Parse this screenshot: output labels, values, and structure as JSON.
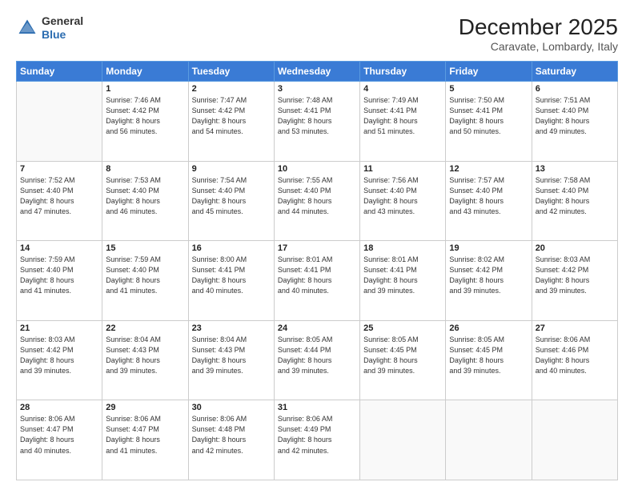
{
  "header": {
    "logo_general": "General",
    "logo_blue": "Blue",
    "month": "December 2025",
    "location": "Caravate, Lombardy, Italy"
  },
  "days_of_week": [
    "Sunday",
    "Monday",
    "Tuesday",
    "Wednesday",
    "Thursday",
    "Friday",
    "Saturday"
  ],
  "weeks": [
    [
      {
        "day": "",
        "info": ""
      },
      {
        "day": "1",
        "info": "Sunrise: 7:46 AM\nSunset: 4:42 PM\nDaylight: 8 hours\nand 56 minutes."
      },
      {
        "day": "2",
        "info": "Sunrise: 7:47 AM\nSunset: 4:42 PM\nDaylight: 8 hours\nand 54 minutes."
      },
      {
        "day": "3",
        "info": "Sunrise: 7:48 AM\nSunset: 4:41 PM\nDaylight: 8 hours\nand 53 minutes."
      },
      {
        "day": "4",
        "info": "Sunrise: 7:49 AM\nSunset: 4:41 PM\nDaylight: 8 hours\nand 51 minutes."
      },
      {
        "day": "5",
        "info": "Sunrise: 7:50 AM\nSunset: 4:41 PM\nDaylight: 8 hours\nand 50 minutes."
      },
      {
        "day": "6",
        "info": "Sunrise: 7:51 AM\nSunset: 4:40 PM\nDaylight: 8 hours\nand 49 minutes."
      }
    ],
    [
      {
        "day": "7",
        "info": "Sunrise: 7:52 AM\nSunset: 4:40 PM\nDaylight: 8 hours\nand 47 minutes."
      },
      {
        "day": "8",
        "info": "Sunrise: 7:53 AM\nSunset: 4:40 PM\nDaylight: 8 hours\nand 46 minutes."
      },
      {
        "day": "9",
        "info": "Sunrise: 7:54 AM\nSunset: 4:40 PM\nDaylight: 8 hours\nand 45 minutes."
      },
      {
        "day": "10",
        "info": "Sunrise: 7:55 AM\nSunset: 4:40 PM\nDaylight: 8 hours\nand 44 minutes."
      },
      {
        "day": "11",
        "info": "Sunrise: 7:56 AM\nSunset: 4:40 PM\nDaylight: 8 hours\nand 43 minutes."
      },
      {
        "day": "12",
        "info": "Sunrise: 7:57 AM\nSunset: 4:40 PM\nDaylight: 8 hours\nand 43 minutes."
      },
      {
        "day": "13",
        "info": "Sunrise: 7:58 AM\nSunset: 4:40 PM\nDaylight: 8 hours\nand 42 minutes."
      }
    ],
    [
      {
        "day": "14",
        "info": "Sunrise: 7:59 AM\nSunset: 4:40 PM\nDaylight: 8 hours\nand 41 minutes."
      },
      {
        "day": "15",
        "info": "Sunrise: 7:59 AM\nSunset: 4:40 PM\nDaylight: 8 hours\nand 41 minutes."
      },
      {
        "day": "16",
        "info": "Sunrise: 8:00 AM\nSunset: 4:41 PM\nDaylight: 8 hours\nand 40 minutes."
      },
      {
        "day": "17",
        "info": "Sunrise: 8:01 AM\nSunset: 4:41 PM\nDaylight: 8 hours\nand 40 minutes."
      },
      {
        "day": "18",
        "info": "Sunrise: 8:01 AM\nSunset: 4:41 PM\nDaylight: 8 hours\nand 39 minutes."
      },
      {
        "day": "19",
        "info": "Sunrise: 8:02 AM\nSunset: 4:42 PM\nDaylight: 8 hours\nand 39 minutes."
      },
      {
        "day": "20",
        "info": "Sunrise: 8:03 AM\nSunset: 4:42 PM\nDaylight: 8 hours\nand 39 minutes."
      }
    ],
    [
      {
        "day": "21",
        "info": "Sunrise: 8:03 AM\nSunset: 4:42 PM\nDaylight: 8 hours\nand 39 minutes."
      },
      {
        "day": "22",
        "info": "Sunrise: 8:04 AM\nSunset: 4:43 PM\nDaylight: 8 hours\nand 39 minutes."
      },
      {
        "day": "23",
        "info": "Sunrise: 8:04 AM\nSunset: 4:43 PM\nDaylight: 8 hours\nand 39 minutes."
      },
      {
        "day": "24",
        "info": "Sunrise: 8:05 AM\nSunset: 4:44 PM\nDaylight: 8 hours\nand 39 minutes."
      },
      {
        "day": "25",
        "info": "Sunrise: 8:05 AM\nSunset: 4:45 PM\nDaylight: 8 hours\nand 39 minutes."
      },
      {
        "day": "26",
        "info": "Sunrise: 8:05 AM\nSunset: 4:45 PM\nDaylight: 8 hours\nand 39 minutes."
      },
      {
        "day": "27",
        "info": "Sunrise: 8:06 AM\nSunset: 4:46 PM\nDaylight: 8 hours\nand 40 minutes."
      }
    ],
    [
      {
        "day": "28",
        "info": "Sunrise: 8:06 AM\nSunset: 4:47 PM\nDaylight: 8 hours\nand 40 minutes."
      },
      {
        "day": "29",
        "info": "Sunrise: 8:06 AM\nSunset: 4:47 PM\nDaylight: 8 hours\nand 41 minutes."
      },
      {
        "day": "30",
        "info": "Sunrise: 8:06 AM\nSunset: 4:48 PM\nDaylight: 8 hours\nand 42 minutes."
      },
      {
        "day": "31",
        "info": "Sunrise: 8:06 AM\nSunset: 4:49 PM\nDaylight: 8 hours\nand 42 minutes."
      },
      {
        "day": "",
        "info": ""
      },
      {
        "day": "",
        "info": ""
      },
      {
        "day": "",
        "info": ""
      }
    ]
  ]
}
